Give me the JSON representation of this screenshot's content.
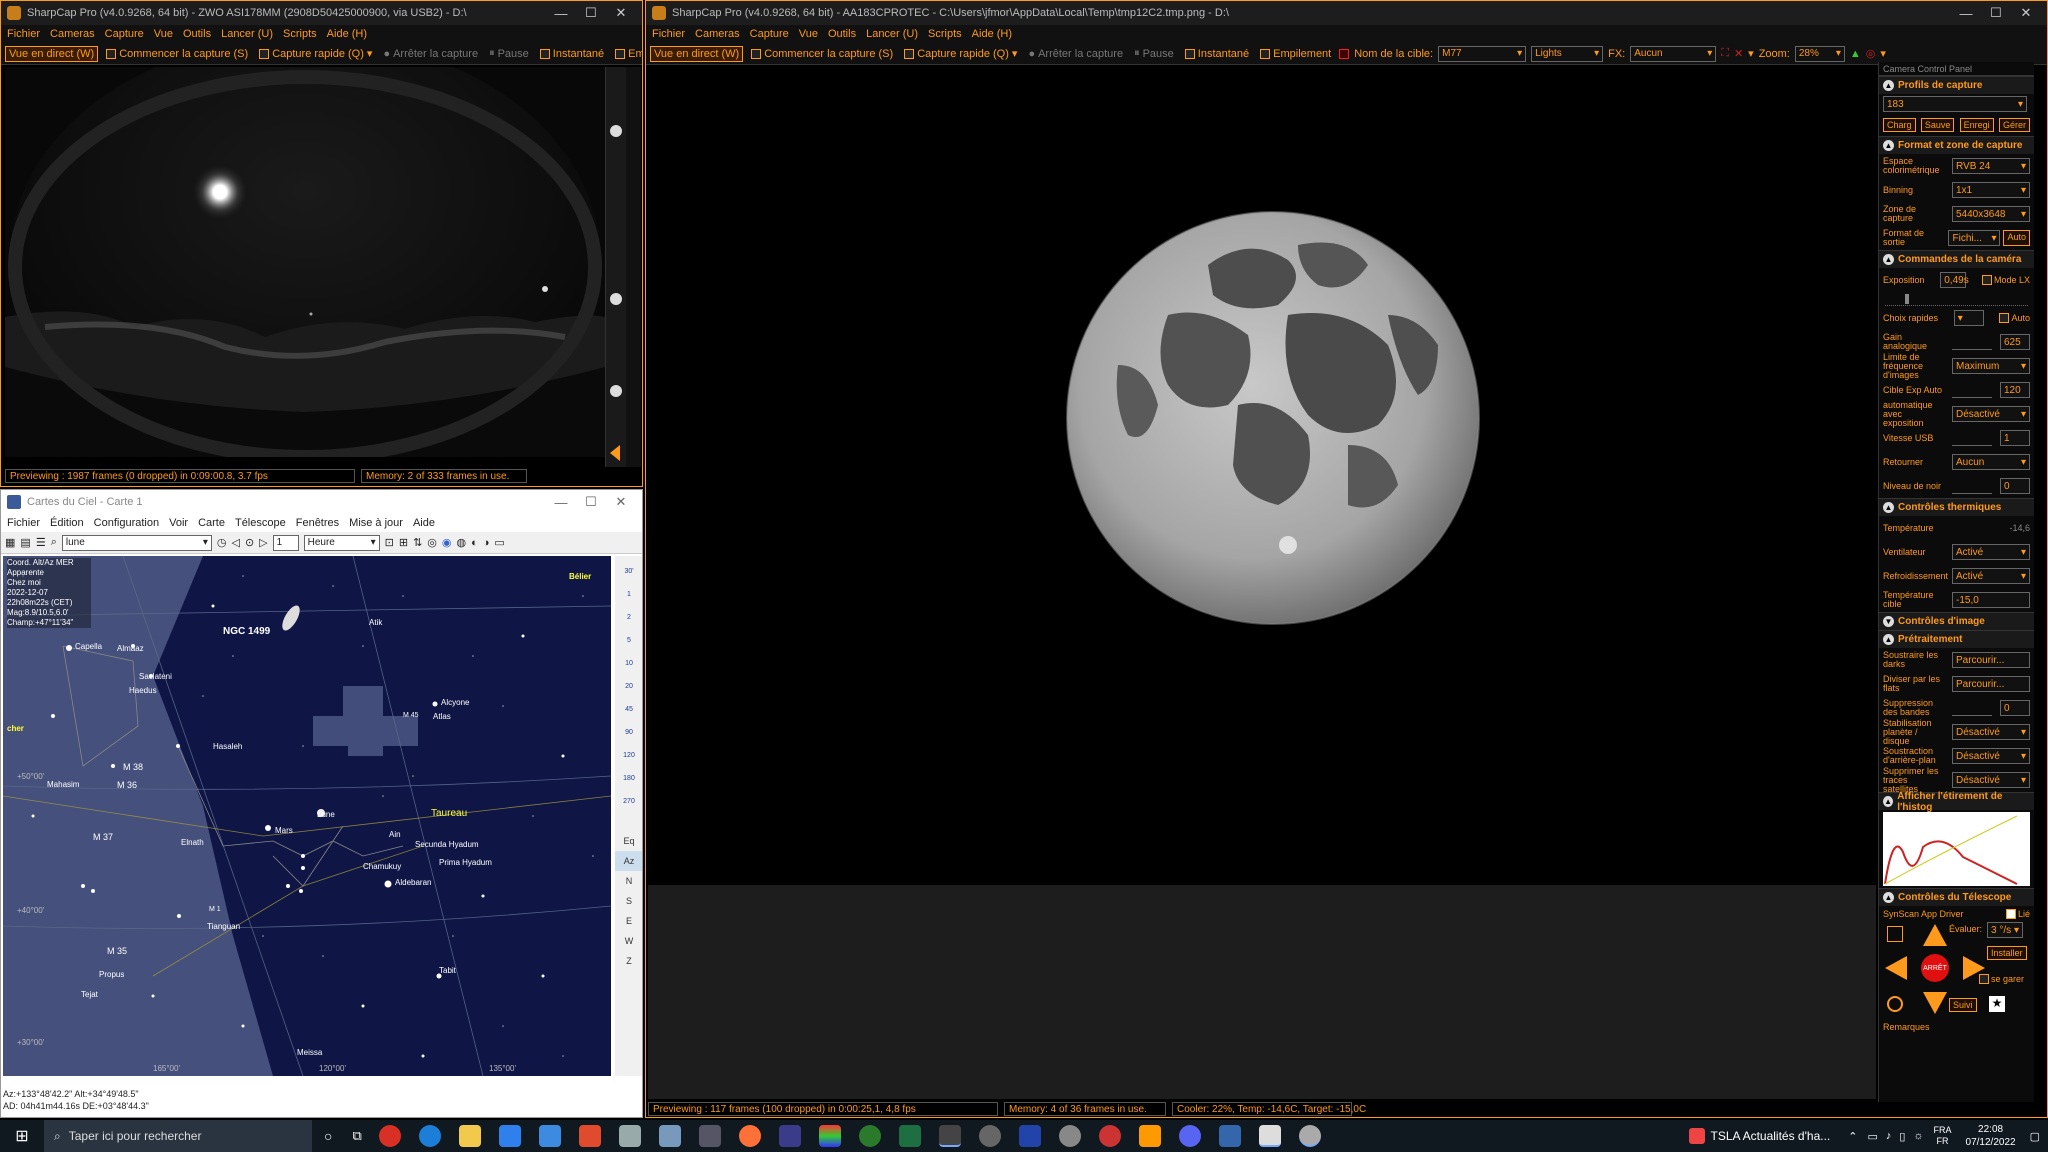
{
  "left_sharpcap": {
    "title": "SharpCap Pro (v4.0.9268, 64 bit) - ZWO ASI178MM (2908D50425000900, via USB2) - D:\\",
    "menu": [
      "Fichier",
      "Cameras",
      "Capture",
      "Vue",
      "Outils",
      "Lancer (U)",
      "Scripts",
      "Aide (H)"
    ],
    "toolbar": {
      "live": "Vue en direct (W)",
      "start": "Commencer la capture (S)",
      "quick": "Capture rapide (Q)",
      "stop": "Arrêter la capture",
      "pause": "Pause",
      "snapshot": "Instantané",
      "stack": "Empilement"
    },
    "status_preview": "Previewing : 1987 frames (0 dropped) in 0:09:00.8, 3.7 fps",
    "status_memory": "Memory: 2 of 333 frames in use."
  },
  "main_sharpcap": {
    "title": "SharpCap Pro (v4.0.9268, 64 bit) - AA183CPROTEC - C:\\Users\\jfmor\\AppData\\Local\\Temp\\tmp12C2.tmp.png - D:\\",
    "menu": [
      "Fichier",
      "Cameras",
      "Capture",
      "Vue",
      "Outils",
      "Lancer (U)",
      "Scripts",
      "Aide (H)"
    ],
    "toolbar": {
      "live": "Vue en direct (W)",
      "start": "Commencer la capture (S)",
      "quick": "Capture rapide (Q)",
      "stop": "Arrêter la capture",
      "pause": "Pause",
      "snapshot": "Instantané",
      "stack": "Empilement",
      "target_label": "Nom de la cible:",
      "target_value": "M77",
      "frame_type": "Lights",
      "fx_label": "FX:",
      "fx_value": "Aucun",
      "zoom_label": "Zoom:",
      "zoom_value": "28%"
    },
    "status_preview": "Previewing : 117 frames (100 dropped) in 0:00:25,1, 4,8 fps",
    "status_memory": "Memory: 4 of 36 frames in use.",
    "status_cooler": "Cooler: 22%, Temp: -14,6C, Target: -15,0C"
  },
  "panel": {
    "header": "Camera Control Panel",
    "profiles": {
      "title": "Profils de capture",
      "value": "183",
      "buttons": [
        "Charg",
        "Sauve",
        "Enregi",
        "Gérer"
      ]
    },
    "format": {
      "title": "Format et zone de capture",
      "rows": [
        {
          "label": "Espace colorimétrique",
          "value": "RVB 24"
        },
        {
          "label": "Binning",
          "value": "1x1"
        },
        {
          "label": "Zone de capture",
          "value": "5440x3648"
        },
        {
          "label": "Format de sortie",
          "value": "Fichi..."
        }
      ],
      "auto": "Auto"
    },
    "camera": {
      "title": "Commandes de la caméra",
      "exposure_label": "Exposition",
      "exposure_value": "0,49s",
      "lx_label": "Mode LX",
      "quick_label": "Choix rapides",
      "auto_label": "Auto",
      "rows": [
        {
          "label": "Gain analogique",
          "value": "625"
        },
        {
          "label": "Limite de fréquence d'images",
          "value": "Maximum"
        },
        {
          "label": "Cible Exp Auto",
          "value": "120"
        },
        {
          "label": "automatique avec exposition",
          "value": "Désactivé"
        },
        {
          "label": "Vitesse USB",
          "value": "1"
        },
        {
          "label": "Retourner",
          "value": "Aucun"
        },
        {
          "label": "Niveau de noir",
          "value": "0"
        }
      ]
    },
    "thermal": {
      "title": "Contrôles thermiques",
      "rows": [
        {
          "label": "Température",
          "value": "-14,6"
        },
        {
          "label": "Ventilateur",
          "value": "Activé"
        },
        {
          "label": "Refroidissement",
          "value": "Activé"
        },
        {
          "label": "Température cible",
          "value": "-15,0"
        }
      ]
    },
    "image": {
      "title": "Contrôles d'image"
    },
    "preprocess": {
      "title": "Prétraitement",
      "rows": [
        {
          "label": "Soustraire les darks",
          "value": "Parcourir..."
        },
        {
          "label": "Diviser par les flats",
          "value": "Parcourir..."
        },
        {
          "label": "Suppression des bandes",
          "value": "0"
        },
        {
          "label": "Stabilisation planète / disque",
          "value": "Désactivé"
        },
        {
          "label": "Soustraction d'arrière-plan",
          "value": "Désactivé"
        },
        {
          "label": "Supprimer les traces satellites",
          "value": "Désactivé"
        }
      ]
    },
    "histogram": {
      "title": "Afficher l'étirement de l'histog"
    },
    "telescope": {
      "title": "Contrôles du Télescope",
      "driver": "SynScan App Driver",
      "linked": "Lié",
      "speed_label": "Évaluer:",
      "speed_value": "3 °/s",
      "install": "Installer",
      "stop": "ARRÊT",
      "park": "se garer",
      "track": "Suivi"
    },
    "notes": "Remarques"
  },
  "cdc": {
    "title": "Cartes du Ciel - Carte 1",
    "menu": [
      "Fichier",
      "Édition",
      "Configuration",
      "Voir",
      "Carte",
      "Télescope",
      "Fenêtres",
      "Mise à jour",
      "Aide"
    ],
    "search": "lune",
    "step_value": "1",
    "step_unit": "Heure",
    "info": [
      "Coord. Alt/Az MER",
      "Apparente",
      "Chez moi",
      "2022-12-07",
      "22h08m22s (CET)",
      "Mag:8.9/10.5,6.0'",
      "Champ:+47°11'34\""
    ],
    "labels": [
      {
        "t": "NGC 1499",
        "cls": "big"
      },
      {
        "t": "Bélier",
        "cls": "yel"
      },
      {
        "t": "Capella"
      },
      {
        "t": "Almaaz"
      },
      {
        "t": "Saclateni"
      },
      {
        "t": "Haedus"
      },
      {
        "t": "Alcyone"
      },
      {
        "t": "Atlas"
      },
      {
        "t": "M 45"
      },
      {
        "t": "Hasaleh"
      },
      {
        "t": "Atik"
      },
      {
        "t": "M 38"
      },
      {
        "t": "M 36"
      },
      {
        "t": "Mahasim"
      },
      {
        "t": "M 37"
      },
      {
        "t": "Elnath"
      },
      {
        "t": "Mars"
      },
      {
        "t": "Lune"
      },
      {
        "t": "Taureau",
        "cls": "yel"
      },
      {
        "t": "Ain"
      },
      {
        "t": "Secunda Hyadum"
      },
      {
        "t": "Chamukuy"
      },
      {
        "t": "Prima Hyadum"
      },
      {
        "t": "Aldebaran"
      },
      {
        "t": "Tianguan"
      },
      {
        "t": "M 1"
      },
      {
        "t": "M 35"
      },
      {
        "t": "Propus"
      },
      {
        "t": "Tejat"
      },
      {
        "t": "Tabit"
      },
      {
        "t": "Meissa"
      },
      {
        "t": "cher",
        "cls": "yel"
      }
    ],
    "grid_labels": [
      "+50°00'",
      "+40°00'",
      "+30°00'",
      "165°00'",
      "120°00'",
      "135°00'"
    ],
    "scale": [
      "30'",
      "1",
      "2",
      "5",
      "10",
      "20",
      "45",
      "90",
      "120",
      "180",
      "270"
    ],
    "side_btns": [
      "Eq",
      "Az",
      "N",
      "S",
      "E",
      "W",
      "Z"
    ],
    "status_line1": "Az:+133°48'42.2\" Alt:+34°49'48.5\"",
    "status_line2": "AD: 04h41m44.16s DE:+03°48'44.3\""
  },
  "taskbar": {
    "search": "Taper ici pour rechercher",
    "news": "TSLA  Actualités d'ha...",
    "lang1": "FRA",
    "lang2": "FR",
    "time": "22:08",
    "date": "07/12/2022"
  }
}
